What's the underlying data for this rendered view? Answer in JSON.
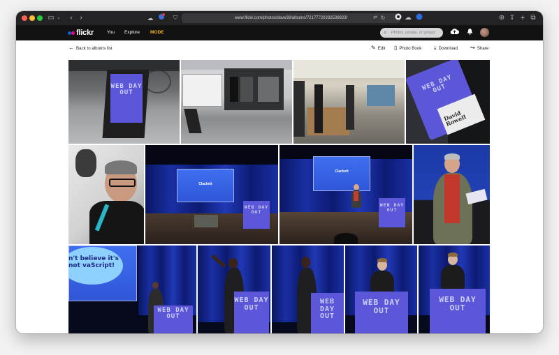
{
  "browser": {
    "url": "www.flickr.com/photos/dave38/albums/72177720332538923/"
  },
  "nav": {
    "logo_text": "flickr",
    "links": [
      "You",
      "Explore",
      "MODE"
    ],
    "search_placeholder": "Photos, people, or groups"
  },
  "toolbar": {
    "back_label": "Back to albums list",
    "edit_label": "Edit",
    "photobook_label": "Photo Book",
    "download_label": "Download",
    "share_label": "Share"
  },
  "photos": {
    "sign_text": "WEB DAY OUT",
    "lanyard_name": "David Rowell",
    "slide_title": "Clackett",
    "quote_text": "n't believe it's not vaScript!"
  },
  "colors": {
    "accent_mode": "#f3b620",
    "flickr_blue": "#0063dc",
    "flickr_pink": "#ff0084",
    "stage_blue": "#1a2fa3",
    "sign_purple": "#5b57d8"
  }
}
